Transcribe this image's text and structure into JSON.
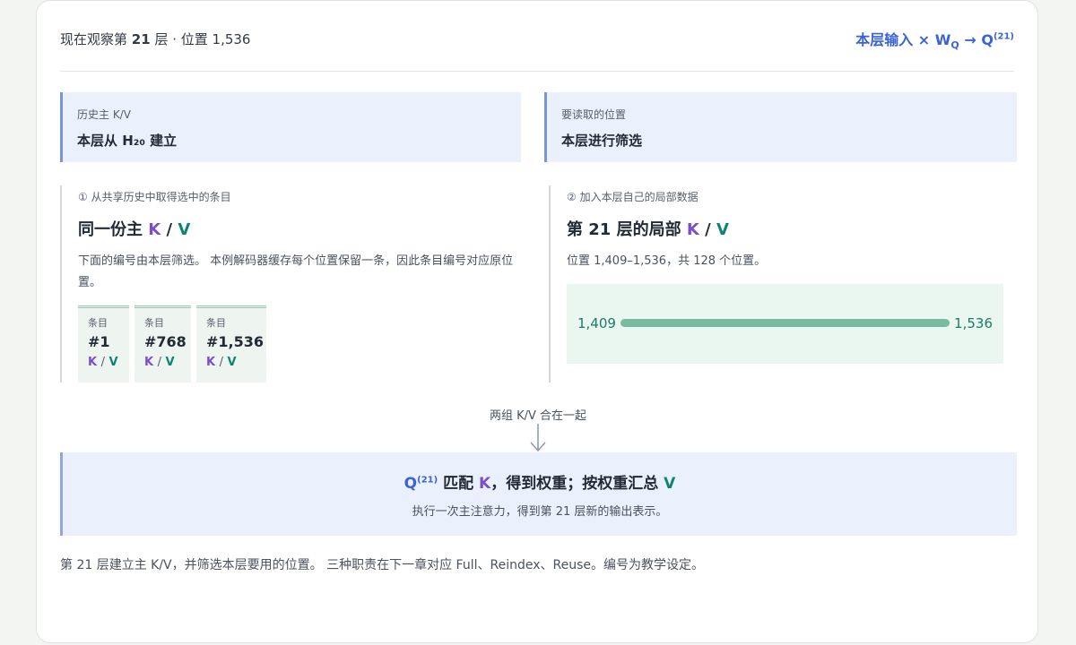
{
  "header": {
    "left_prefix": "现在观察第",
    "layer": "21",
    "left_suffix": "层 · 位置 1,536",
    "formula_main": "本层输入 × W",
    "formula_sub": "Q",
    "formula_arrow": " → Q",
    "formula_sup": "(21)"
  },
  "top_left": {
    "label": "历史主 K/V",
    "value": "本层从 H₂₀ 建立"
  },
  "top_right": {
    "label": "要读取的位置",
    "value": "本层进行筛选"
  },
  "left_col": {
    "step": "① 从共享历史中取得选中的条目",
    "title_prefix": "同一份主",
    "k": "K",
    "slash": "/",
    "v": "V",
    "desc": "下面的编号由本层筛选。 本例解码器缓存每个位置保留一条，因此条目编号对应原位置。",
    "entries": [
      {
        "label": "条目",
        "num": "#1",
        "k": "K",
        "slash": "/",
        "v": "V"
      },
      {
        "label": "条目",
        "num": "#768",
        "k": "K",
        "slash": "/",
        "v": "V"
      },
      {
        "label": "条目",
        "num": "#1,536",
        "k": "K",
        "slash": "/",
        "v": "V"
      }
    ]
  },
  "right_col": {
    "step": "② 加入本层自己的局部数据",
    "title_prefix": "第 21 层的局部",
    "k": "K",
    "slash": "/",
    "v": "V",
    "desc": "位置 1,409–1,536，共 128 个位置。",
    "range_from": "1,409",
    "range_to": "1,536"
  },
  "merge_label": "两组 K/V 合在一起",
  "bottom": {
    "q": "Q",
    "q_sup": "(21)",
    "t1": " 匹配 ",
    "k": "K",
    "t2": "，得到权重；按权重汇总 ",
    "v": "V",
    "sub": "执行一次主注意力，得到第 21 层新的输出表示。"
  },
  "footer": "第 21 层建立主 K/V，并筛选本层要用的位置。 三种职责在下一章对应 Full、Reindex、Reuse。编号为教学设定。",
  "colors": {
    "k": "#7b4fcc",
    "v": "#0f8470",
    "accent": "#3a63d6",
    "bar": "#78bb9e"
  }
}
